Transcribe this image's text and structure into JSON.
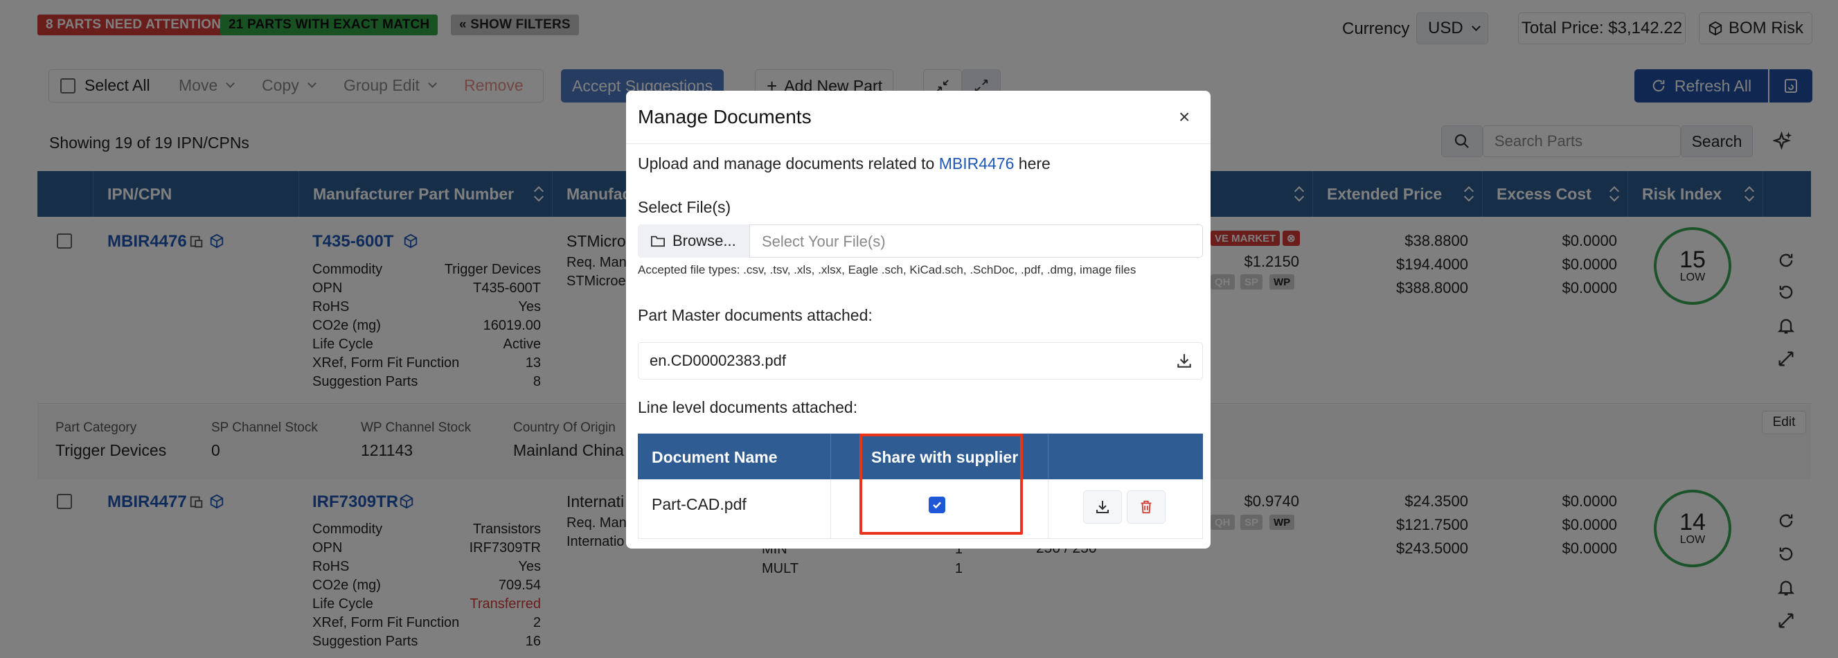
{
  "alerts": {
    "attention": "8 PARTS NEED ATTENTION",
    "exact": "21 PARTS WITH EXACT MATCH",
    "filters": "« SHOW FILTERS"
  },
  "top": {
    "currency_label": "Currency",
    "currency": "USD",
    "total_price": "Total Price: $3,142.22",
    "bom_risk": "BOM Risk"
  },
  "toolbar": {
    "select_all": "Select All",
    "move": "Move",
    "copy": "Copy",
    "group_edit": "Group Edit",
    "remove": "Remove",
    "accept": "Accept Suggestions",
    "add_part": "Add New Part",
    "refresh_all": "Refresh All"
  },
  "list": {
    "showing": "Showing 19 of 19 IPN/CPNs",
    "search_placeholder": "Search Parts",
    "search_button": "Search"
  },
  "columns": [
    "IPN/CPN",
    "Manufacturer Part Number",
    "Manufac",
    "Extended Price",
    "Excess Cost",
    "Risk Index"
  ],
  "rows": [
    {
      "ipn": "MBIR4476",
      "mpn": "T435-600T",
      "manufacturer": "STMicro",
      "req": "Req. Man",
      "req2": "STMicroe",
      "fields": [
        {
          "label": "Commodity",
          "value": "Trigger Devices"
        },
        {
          "label": "OPN",
          "value": "T435-600T"
        },
        {
          "label": "RoHS",
          "value": "Yes"
        },
        {
          "label": "CO2e (mg)",
          "value": "16019.00"
        },
        {
          "label": "Life Cycle",
          "value": "Active"
        },
        {
          "label": "XRef, Form Fit Function",
          "value": "13"
        },
        {
          "label": "Suggestion Parts",
          "value": "8"
        }
      ],
      "market_badge": "VE MARKET",
      "unit_price": "$1.2150",
      "chips": [
        "QH",
        "SP",
        "WP"
      ],
      "ext_prices": [
        "$38.8800",
        "$194.4000",
        "$388.8000"
      ],
      "excess": [
        "$0.0000",
        "$0.0000",
        "$0.0000"
      ],
      "risk": "15",
      "risk_level": "LOW"
    },
    {
      "ipn": "MBIR4477",
      "mpn": "IRF7309TR",
      "manufacturer": "Internati",
      "req": "Req. Man",
      "req2": "Internatio",
      "fields": [
        {
          "label": "Commodity",
          "value": "Transistors"
        },
        {
          "label": "OPN",
          "value": "IRF7309TR"
        },
        {
          "label": "RoHS",
          "value": "Yes"
        },
        {
          "label": "CO2e (mg)",
          "value": "709.54"
        },
        {
          "label": "Life Cycle",
          "value": "Transferred"
        },
        {
          "label": "XRef, Form Fit Function",
          "value": "2"
        },
        {
          "label": "Suggestion Parts",
          "value": "16"
        }
      ],
      "unit_price": "$0.9740",
      "chips": [
        "QH",
        "SP",
        "WP"
      ],
      "ext_prices": [
        "$24.3500",
        "$121.7500",
        "$243.5000"
      ],
      "excess": [
        "$0.0000",
        "$0.0000",
        "$0.0000"
      ],
      "risk": "14",
      "risk_level": "LOW",
      "extra": [
        {
          "label": "MIN",
          "value": "1"
        },
        {
          "label": "MULT",
          "value": "1"
        }
      ],
      "stock": "250 / 250"
    }
  ],
  "details": [
    {
      "label": "Part Category",
      "value": "Trigger Devices"
    },
    {
      "label": "SP Channel Stock",
      "value": "0"
    },
    {
      "label": "WP Channel Stock",
      "value": "121143"
    },
    {
      "label": "Country Of Origin",
      "value": "Mainland China"
    }
  ],
  "edit": "Edit",
  "modal": {
    "title": "Manage Documents",
    "intro_pre": "Upload and manage documents related to",
    "intro_link": "MBIR4476",
    "intro_post": "here",
    "select_files": "Select File(s)",
    "browse": "Browse...",
    "file_placeholder": "Select Your File(s)",
    "accepted": "Accepted file types: .csv, .tsv, .xls, .xlsx, Eagle .sch, KiCad.sch, .SchDoc, .pdf, .dmg, image files",
    "master_heading": "Part Master documents attached:",
    "master_file": "en.CD00002383.pdf",
    "line_heading": "Line level documents attached:",
    "col_name": "Document Name",
    "col_share": "Share with supplier",
    "doc_name": "Part-CAD.pdf",
    "shared": true
  },
  "colors": {
    "header_blue": "#2f5d93",
    "primary": "#1f4fa3",
    "danger": "#d33c36",
    "success": "#33a544",
    "highlight": "#e8341c"
  }
}
